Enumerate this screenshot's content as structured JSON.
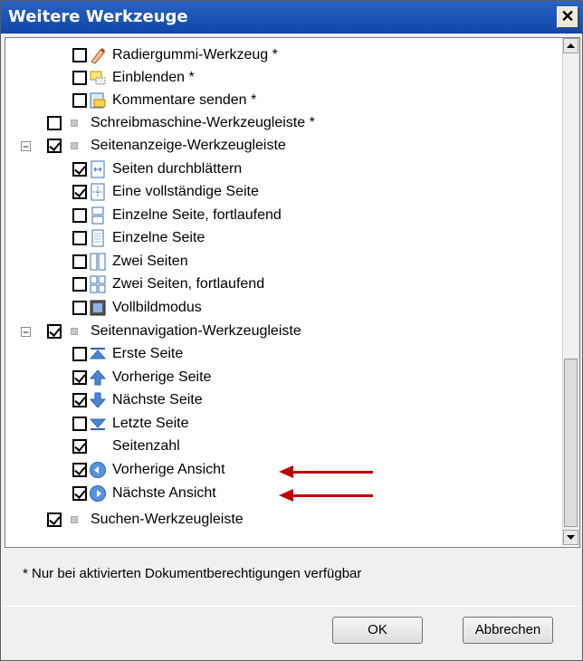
{
  "window": {
    "title": "Weitere Werkzeuge",
    "close_glyph": "✕"
  },
  "tree": {
    "items": [
      {
        "label": "Radiergummi-Werkzeug *",
        "checked": false,
        "icon": "eraser-icon"
      },
      {
        "label": "Einblenden *",
        "checked": false,
        "icon": "show-comments-icon"
      },
      {
        "label": "Kommentare senden *",
        "checked": false,
        "icon": "send-comments-icon"
      },
      {
        "label": "Schreibmaschine-Werkzeugleiste *",
        "checked": false,
        "icon": "toolbar-bullet-icon"
      },
      {
        "label": "Seitenanzeige-Werkzeugleiste",
        "checked": true,
        "icon": "toolbar-bullet-icon",
        "expander": "−"
      },
      {
        "label": "Seiten durchblättern",
        "checked": true,
        "icon": "page-scroll-icon"
      },
      {
        "label": "Eine vollständige Seite",
        "checked": true,
        "icon": "fit-page-icon"
      },
      {
        "label": "Einzelne Seite, fortlaufend",
        "checked": false,
        "icon": "single-continuous-icon"
      },
      {
        "label": "Einzelne Seite",
        "checked": false,
        "icon": "single-page-icon"
      },
      {
        "label": "Zwei Seiten",
        "checked": false,
        "icon": "two-pages-icon"
      },
      {
        "label": "Zwei Seiten, fortlaufend",
        "checked": false,
        "icon": "two-pages-continuous-icon"
      },
      {
        "label": "Vollbildmodus",
        "checked": false,
        "icon": "fullscreen-icon"
      },
      {
        "label": "Seitennavigation-Werkzeugleiste",
        "checked": true,
        "icon": "toolbar-bullet-icon",
        "expander": "−"
      },
      {
        "label": "Erste Seite",
        "checked": false,
        "icon": "first-page-icon"
      },
      {
        "label": "Vorherige Seite",
        "checked": true,
        "icon": "previous-page-icon"
      },
      {
        "label": "Nächste Seite",
        "checked": true,
        "icon": "next-page-icon"
      },
      {
        "label": "Letzte Seite",
        "checked": false,
        "icon": "last-page-icon"
      },
      {
        "label": "Seitenzahl",
        "checked": true,
        "icon": "none"
      },
      {
        "label": "Vorherige Ansicht",
        "checked": true,
        "icon": "previous-view-icon"
      },
      {
        "label": "Nächste Ansicht",
        "checked": true,
        "icon": "next-view-icon"
      },
      {
        "label": "Suchen-Werkzeugleiste",
        "checked": true,
        "icon": "toolbar-bullet-icon"
      }
    ]
  },
  "footer": {
    "note": "* Nur bei aktivierten Dokumentberechtigungen verfügbar",
    "ok_label": "OK",
    "cancel_label": "Abbrechen"
  },
  "colors": {
    "titlebar": "#1f56b8",
    "annotation_arrow": "#c00000"
  }
}
